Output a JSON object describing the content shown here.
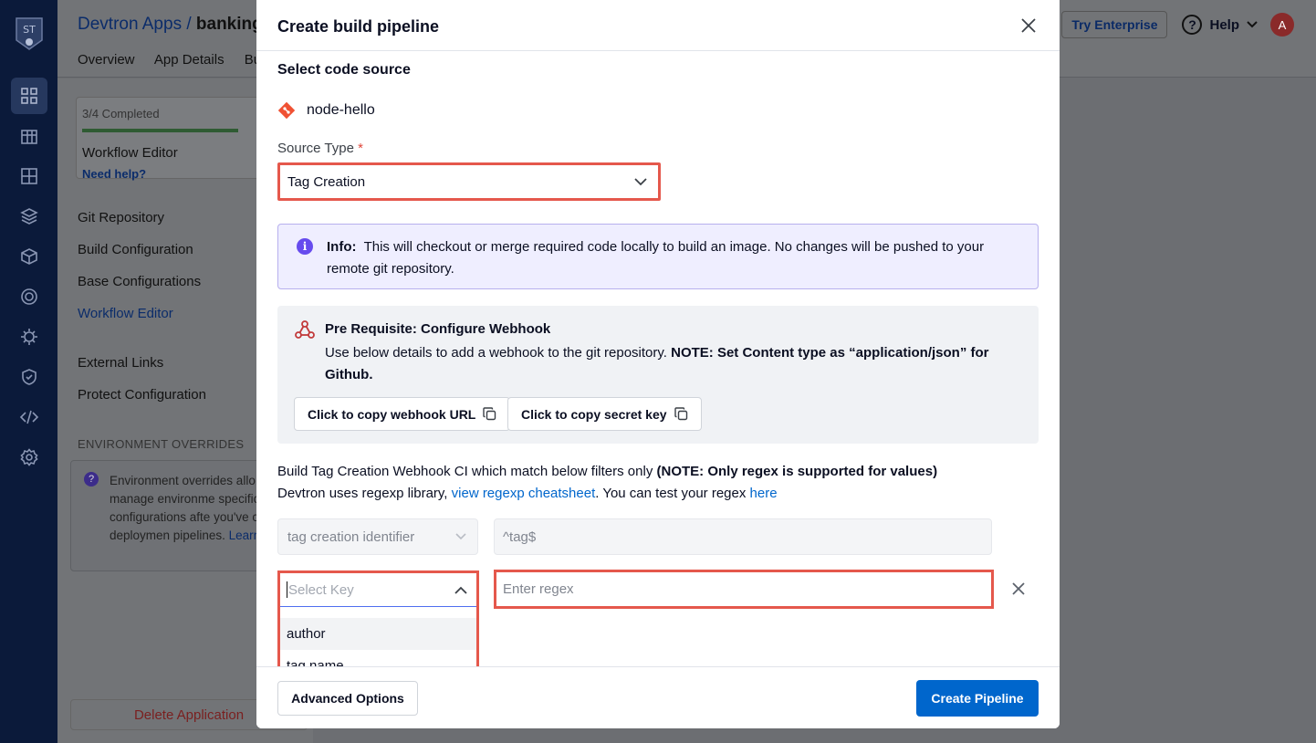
{
  "background": {
    "nav_logo": "ST",
    "breadcrumb": {
      "parent": "Devtron Apps /",
      "current": "banking"
    },
    "tabs": [
      "Overview",
      "App Details",
      "Bui"
    ],
    "try_enterprise": "Try Enterprise",
    "help_label": "Help",
    "avatar_initial": "A",
    "progress": {
      "status": "3/4 Completed",
      "title": "Workflow Editor",
      "help_link": "Need help?",
      "fraction": 0.75
    },
    "menu": [
      "Git Repository",
      "Build Configuration",
      "Base Configurations",
      "Workflow Editor",
      "External Links",
      "Protect Configuration"
    ],
    "env_section": "ENVIRONMENT OVERRIDES",
    "env_text": "Environment overrides allo you to manage environme specific configurations afte you've created deploymen pipelines.",
    "env_learn_more": "Learn more",
    "delete_app": "Delete Application"
  },
  "modal": {
    "title": "Create build pipeline",
    "section_title": "Select code source",
    "repo_name": "node-hello",
    "source_type_label": "Source Type",
    "required_mark": "*",
    "source_type_value": "Tag Creation",
    "info": {
      "label": "Info:",
      "text": "This will checkout or merge required code locally to build an image. No changes will be pushed to your remote git repository."
    },
    "prereq": {
      "title": "Pre Requisite: Configure Webhook",
      "text": "Use below details to add a webhook to the git repository.",
      "note": "NOTE: Set Content type as “application/json” for Github.",
      "copy_url": "Click to copy webhook URL",
      "copy_secret": "Click to copy secret key"
    },
    "filter": {
      "line1": "Build Tag Creation Webhook CI which match below filters only",
      "line1_note": "(NOTE: Only regex is supported for values)",
      "line2_pre": "Devtron uses regexp library,",
      "cheatsheet_link": "view regexp cheatsheet",
      "line2_mid": ". You can test your regex",
      "here_link": "here"
    },
    "fixed_filter": {
      "key": "tag creation identifier",
      "value": "^tag$"
    },
    "new_filter": {
      "key_placeholder": "Select Key",
      "value_placeholder": "Enter regex",
      "options": [
        "author",
        "tag name"
      ]
    },
    "footer": {
      "advanced": "Advanced Options",
      "create": "Create Pipeline"
    }
  }
}
